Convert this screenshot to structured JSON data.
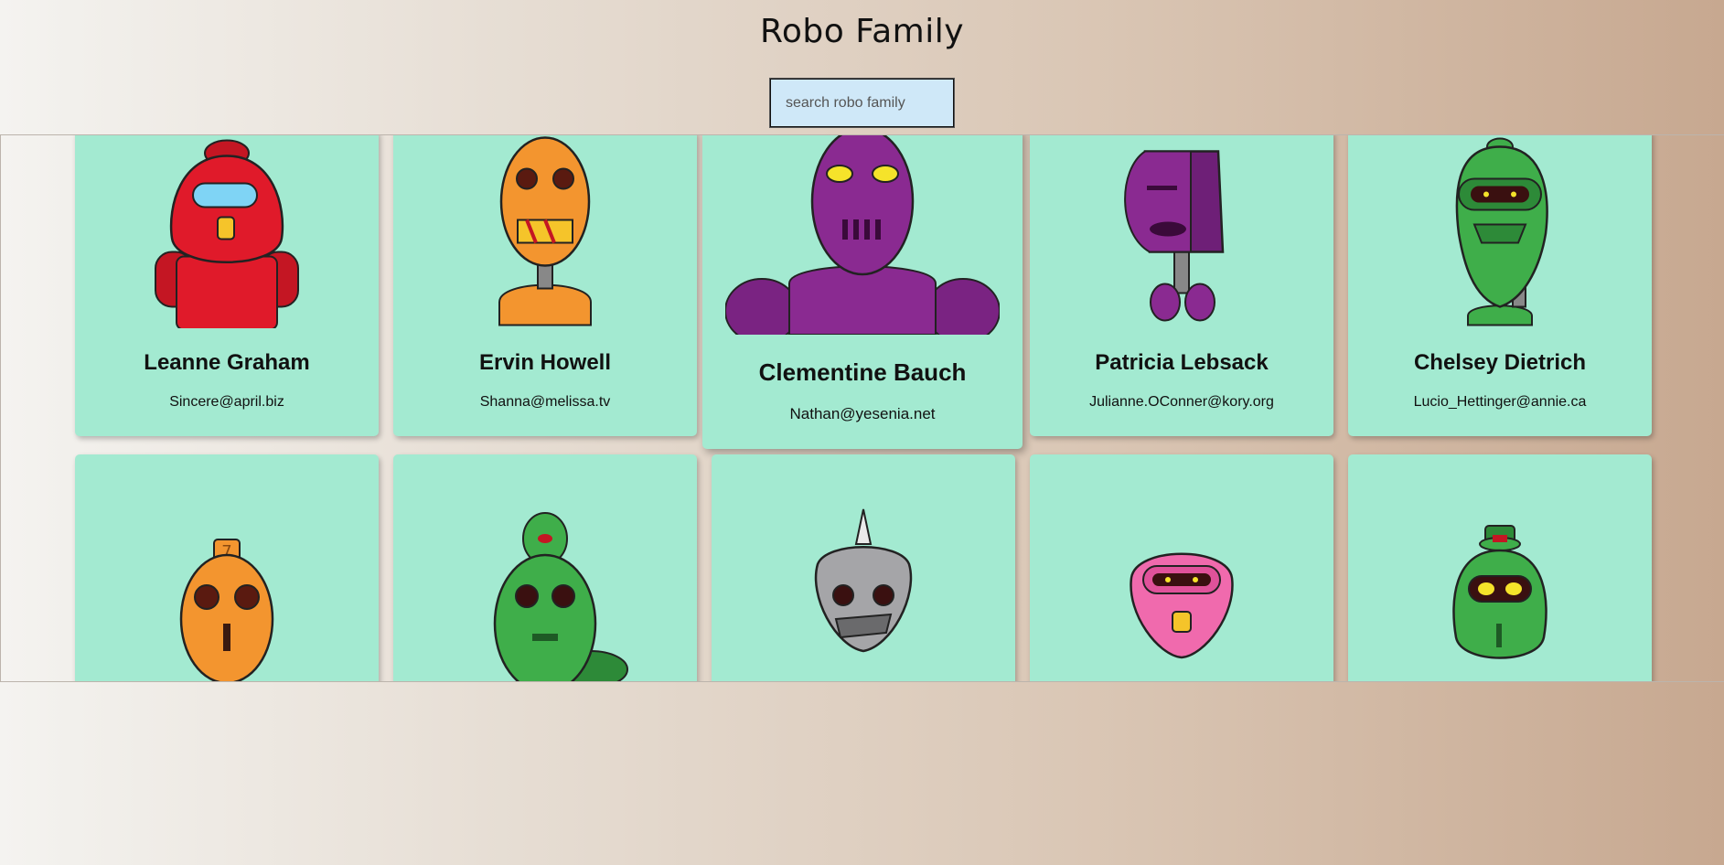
{
  "header": {
    "title": "Robo Family"
  },
  "search": {
    "placeholder": "search robo family",
    "value": ""
  },
  "robots": [
    {
      "name": "Leanne Graham",
      "email": "Sincere@april.biz",
      "color": "#e01a2a",
      "icon": "red-robot-icon"
    },
    {
      "name": "Ervin Howell",
      "email": "Shanna@melissa.tv",
      "color": "#f3952f",
      "icon": "orange-robot-icon"
    },
    {
      "name": "Clementine Bauch",
      "email": "Nathan@yesenia.net",
      "color": "#8a2a91",
      "icon": "purple-robot-icon"
    },
    {
      "name": "Patricia Lebsack",
      "email": "Julianne.OConner@kory.org",
      "color": "#7f2a88",
      "icon": "purple-robot-icon"
    },
    {
      "name": "Chelsey Dietrich",
      "email": "Lucio_Hettinger@annie.ca",
      "color": "#3fae4a",
      "icon": "green-robot-icon"
    },
    {
      "name": "",
      "email": "",
      "color": "#f3952f",
      "icon": "orange-robot-icon"
    },
    {
      "name": "",
      "email": "",
      "color": "#3fae4a",
      "icon": "green-robot-icon"
    },
    {
      "name": "",
      "email": "",
      "color": "#a5a5a8",
      "icon": "gray-robot-icon"
    },
    {
      "name": "",
      "email": "",
      "color": "#f06aad",
      "icon": "pink-robot-icon"
    },
    {
      "name": "",
      "email": "",
      "color": "#3fae4a",
      "icon": "green-robot-icon"
    }
  ]
}
